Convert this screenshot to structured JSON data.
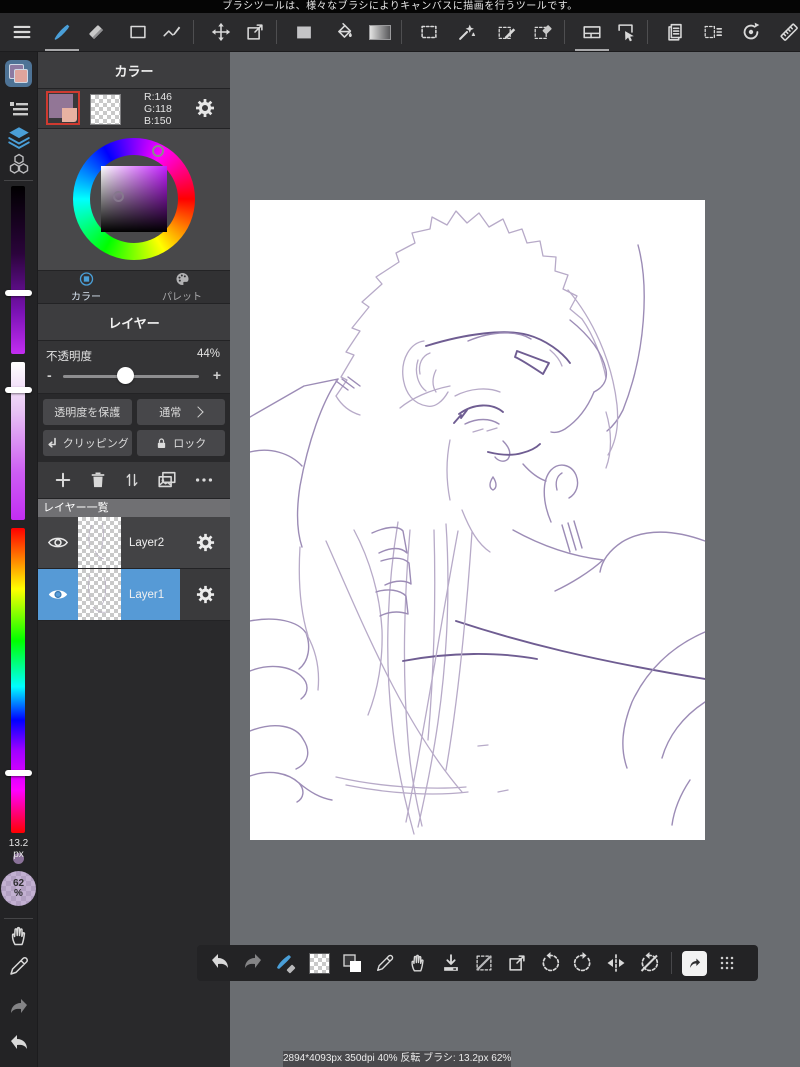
{
  "tooltip_bar": {
    "text": "ブラシツールは、様々なブラシによりキャンバスに描画を行うツールです。"
  },
  "top_toolbar": {
    "active_tool": "brush",
    "accent_color": "#4a9fd8",
    "tools": [
      "menu",
      "brush",
      "eraser",
      "rectangle",
      "polyline",
      "move",
      "transform",
      "fill-rect",
      "bucket",
      "gradient",
      "select-rect",
      "magic-wand",
      "select-pen",
      "select-eraser",
      "panel-layout",
      "select-cursor",
      "pages",
      "select-list",
      "rotate-reset",
      "ruler",
      "airbrush"
    ]
  },
  "left_sidebar": {
    "icons": [
      "color-swatch-panel",
      "brush-list-panel",
      "layers-panel",
      "materials-panel"
    ],
    "sliders": [
      "value-slider",
      "saturation-slider",
      "hue-slider"
    ],
    "brush_size": "13.2",
    "brush_size_unit": "px",
    "zoom_value": "62",
    "zoom_unit": "%",
    "bottom_icons": [
      "hand",
      "eyedropper",
      "redo",
      "undo"
    ]
  },
  "color_panel": {
    "title": "カラー",
    "foreground_color": "#927696",
    "rgb": {
      "r": "R:146",
      "g": "G:118",
      "b": "B:150"
    },
    "tabs": [
      {
        "label": "カラー",
        "active": true
      },
      {
        "label": "パレット",
        "active": false
      }
    ]
  },
  "layer_panel": {
    "title": "レイヤー",
    "opacity_label": "不透明度",
    "opacity_value": "44%",
    "opacity_minus": "-",
    "opacity_plus": "+",
    "protect_label": "透明度を保護",
    "blend_label": "通常",
    "clipping_label": "クリッピング",
    "lock_label": "ロック",
    "toolbar_icons": [
      "add-layer",
      "delete-layer",
      "reorder-layers",
      "duplicate-layer",
      "more-options"
    ],
    "list_title": "レイヤー一覧",
    "layers": [
      {
        "name": "Layer2",
        "selected": false,
        "visible": true
      },
      {
        "name": "Layer1",
        "selected": true,
        "visible": true
      }
    ]
  },
  "bottom_toolbar": {
    "tools": [
      "undo",
      "redo",
      "brush-eraser-toggle",
      "transparent-color",
      "swap-colors",
      "eyedropper",
      "hand",
      "save",
      "deselect",
      "transform",
      "rotate-ccw",
      "rotate-cw",
      "flip-horizontal",
      "reset-rotation",
      "shortcut",
      "grid-handle"
    ]
  },
  "status_bar": {
    "text": "2894*4093px 350dpi 40% 反転 ブラシ: 13.2px 62%"
  }
}
